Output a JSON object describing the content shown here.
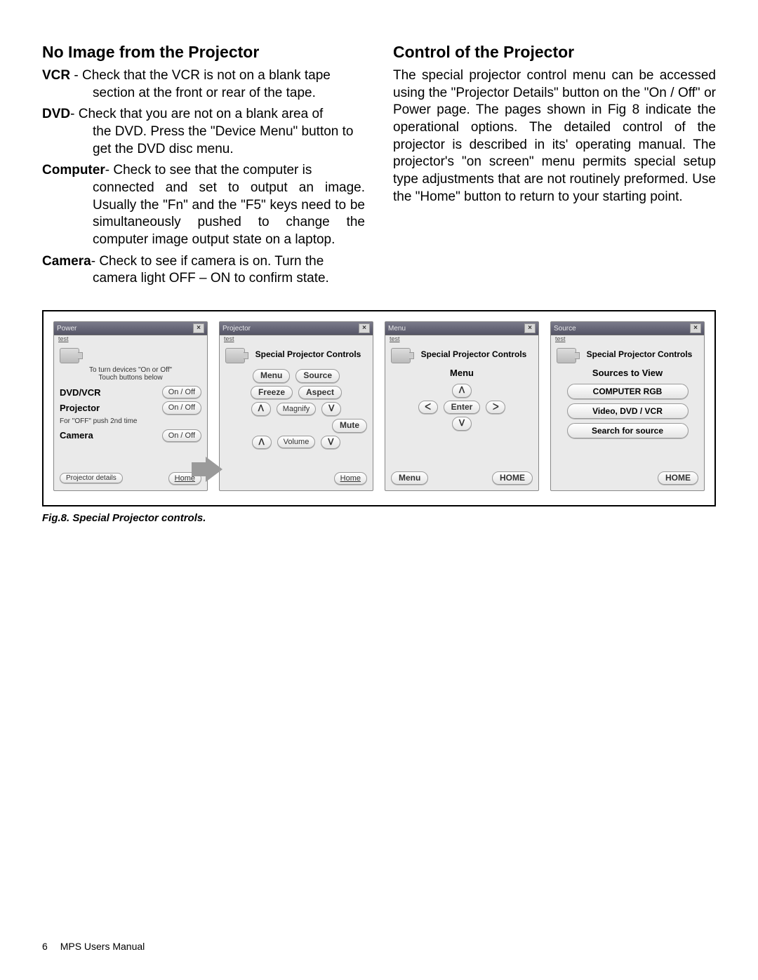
{
  "left": {
    "heading": "No Image from the Projector",
    "items": [
      {
        "label": "VCR",
        "sep": " - ",
        "first": "Check that the VCR is not on a blank tape",
        "rest": "section at the front or rear of the tape."
      },
      {
        "label": "DVD",
        "sep": "- ",
        "first": "Check that you are not on a blank area of",
        "rest": "the DVD. Press the \"Device Menu\" button to get the DVD disc menu."
      },
      {
        "label": "Computer",
        "sep": "- ",
        "first": "Check to see that the computer is",
        "rest": "connected and set to output an image. Usually the \"Fn\" and the \"F5\" keys need to be simultaneously pushed to change the computer image output state on a laptop.",
        "justify": true
      },
      {
        "label": "Camera",
        "sep": "- ",
        "first": "Check to see if camera is on. Turn the",
        "rest": "camera light OFF – ON to confirm state."
      }
    ]
  },
  "right": {
    "heading": "Control of the Projector",
    "body": "The special projector control menu can be accessed using the \"Projector Details\" button on the \"On / Off\" or Power page. The pages shown in Fig 8 indicate the operational options. The detailed control of the projector is described in its' operating manual.  The projector's \"on screen\" menu permits special setup type adjustments that are not routinely preformed. Use the \"Home\" button to return to your starting point."
  },
  "fig": {
    "caption": "Fig.8. Special Projector controls.",
    "panel1": {
      "title": "Power",
      "sub": "test",
      "line1": "To turn devices \"On or Off\"",
      "line2": "Touch buttons below",
      "dvdvcr": "DVD/VCR",
      "onoff": "On / Off",
      "projector": "Projector",
      "note": "For \"OFF\" push 2nd time",
      "camera": "Camera",
      "details": "Projector details",
      "home": "Home"
    },
    "panel2": {
      "title": "Projector",
      "sub": "test",
      "heading": "Special Projector Controls",
      "menu": "Menu",
      "source": "Source",
      "freeze": "Freeze",
      "aspect": "Aspect",
      "magnify": "Magnify",
      "mute": "Mute",
      "volume": "Volume",
      "up": "ᐱ",
      "down": "ᐯ",
      "home": "Home"
    },
    "panel3": {
      "title": "Menu",
      "sub": "test",
      "heading": "Special Projector Controls",
      "menuLabel": "Menu",
      "enter": "Enter",
      "up": "ᐱ",
      "down": "ᐯ",
      "left": "ᐸ",
      "right": "ᐳ",
      "menuBtn": "Menu",
      "home": "HOME"
    },
    "panel4": {
      "title": "Source",
      "sub": "test",
      "heading": "Special Projector Controls",
      "sources": "Sources to View",
      "btn1": "COMPUTER  RGB",
      "btn2": "Video, DVD / VCR",
      "btn3": "Search for source",
      "home": "HOME"
    }
  },
  "footer": {
    "page": "6",
    "doc": "MPS Users Manual"
  }
}
